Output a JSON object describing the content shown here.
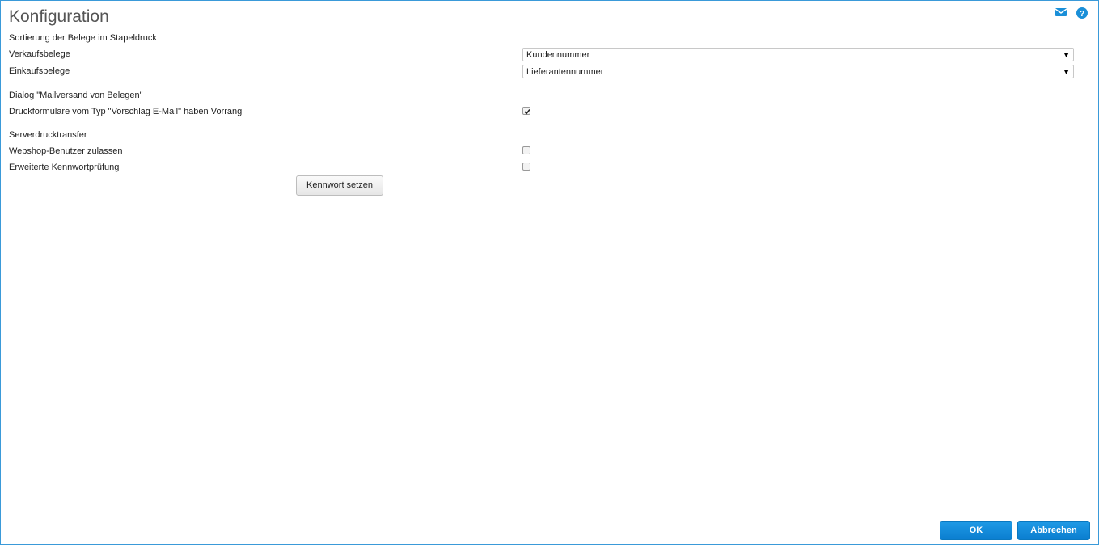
{
  "window": {
    "title": "Konfiguration"
  },
  "sections": {
    "sorting": {
      "heading": "Sortierung der Belege im Stapeldruck",
      "sales_label": "Verkaufsbelege",
      "sales_value": "Kundennummer",
      "purchase_label": "Einkaufsbelege",
      "purchase_value": "Lieferantennummer"
    },
    "mail": {
      "heading": "Dialog \"Mailversand von Belegen\"",
      "priority_label": "Druckformulare vom Typ \"Vorschlag E-Mail\" haben Vorrang",
      "priority_checked": true
    },
    "server": {
      "heading": "Serverdrucktransfer",
      "webshop_label": "Webshop-Benutzer zulassen",
      "webshop_checked": false,
      "password_check_label": "Erweiterte Kennwortprüfung",
      "password_check_checked": false,
      "set_password_button": "Kennwort setzen"
    }
  },
  "footer": {
    "ok_label": "OK",
    "cancel_label": "Abbrechen"
  },
  "colors": {
    "accent": "#0b7ed0",
    "border": "#3a9ad9"
  },
  "icons": [
    "mail-icon",
    "help-icon"
  ]
}
